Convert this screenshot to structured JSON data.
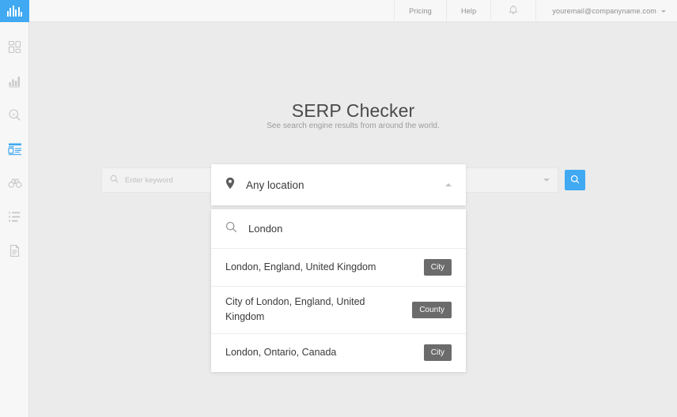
{
  "brand": {
    "logo_icon": "audio-bars-logo-icon",
    "accent_color": "#40a9f2",
    "background_color": "#ebebeb"
  },
  "sidebar": {
    "items": [
      {
        "icon": "dashboard-grid-icon",
        "name": "sidebar-item-dashboard",
        "active": false
      },
      {
        "icon": "bar-chart-icon",
        "name": "sidebar-item-rank-tracker",
        "active": false
      },
      {
        "icon": "keyword-magnifier-icon",
        "name": "sidebar-item-keyword-finder",
        "active": false
      },
      {
        "icon": "browser-window-icon",
        "name": "sidebar-item-serp-checker",
        "active": true
      },
      {
        "icon": "binoculars-icon",
        "name": "sidebar-item-serp-watcher",
        "active": false
      },
      {
        "icon": "list-icon",
        "name": "sidebar-item-link-list",
        "active": false
      },
      {
        "icon": "document-icon",
        "name": "sidebar-item-reports",
        "active": false
      }
    ]
  },
  "header": {
    "pricing_label": "Pricing",
    "help_label": "Help",
    "notifications_icon": "bell-icon",
    "user_email": "youremail@companyname.com",
    "user_caret_icon": "chevron-down-icon"
  },
  "main": {
    "title": "SERP Checker",
    "subtitle": "See search engine results from around the world."
  },
  "search": {
    "keyword_icon": "search-icon",
    "keyword_value": "",
    "keyword_placeholder": "Enter keyword",
    "engine_caret_icon": "chevron-down-icon",
    "submit_icon": "search-icon"
  },
  "location_dropdown": {
    "pin_icon": "map-pin-icon",
    "selected_label": "Any location",
    "collapse_icon": "chevron-up-icon",
    "search_icon": "search-icon",
    "search_value": "London",
    "results": [
      {
        "name": "London, England, United Kingdom",
        "badge": "City"
      },
      {
        "name": "City of London, England, United Kingdom",
        "badge": "County"
      },
      {
        "name": "London, Ontario, Canada",
        "badge": "City"
      }
    ]
  }
}
